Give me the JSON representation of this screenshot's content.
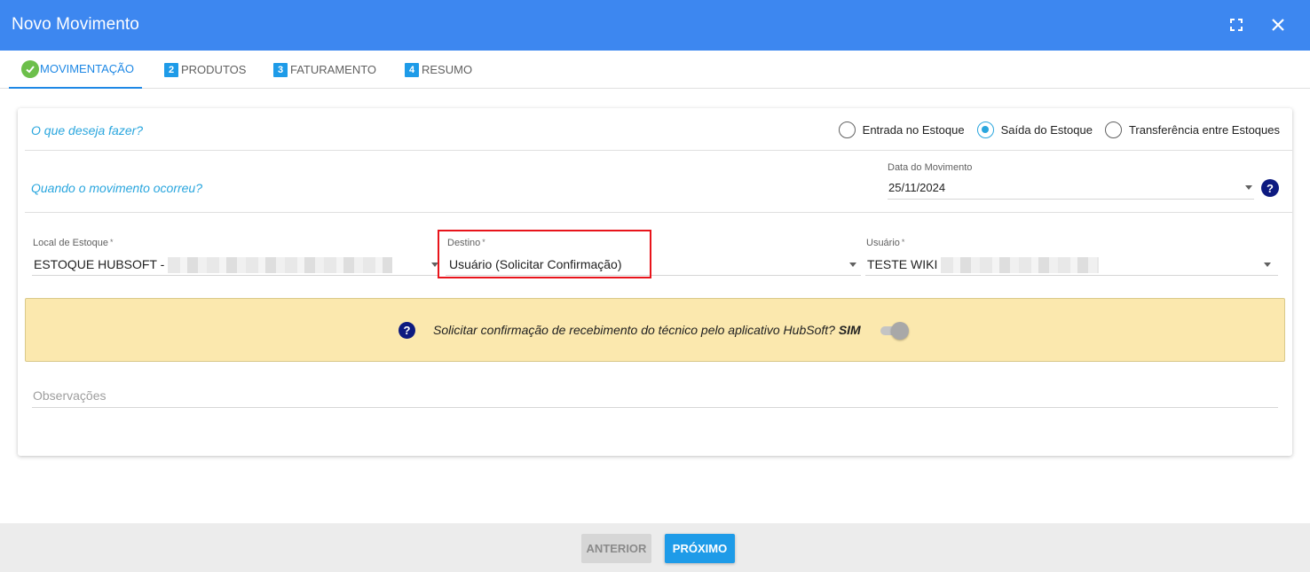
{
  "window": {
    "title": "Novo Movimento",
    "maximize_icon": "fullscreen-icon",
    "close_icon": "close-icon"
  },
  "tabs": [
    {
      "label": "MOVIMENTAÇÃO",
      "badge": "",
      "state": "completed"
    },
    {
      "label": "PRODUTOS",
      "badge": "2",
      "state": "pending"
    },
    {
      "label": "FATURAMENTO",
      "badge": "3",
      "state": "pending"
    },
    {
      "label": "RESUMO",
      "badge": "4",
      "state": "pending"
    }
  ],
  "section_action": {
    "question": "O que deseja fazer?",
    "options": [
      {
        "label": "Entrada no Estoque",
        "selected": false
      },
      {
        "label": "Saída do Estoque",
        "selected": true
      },
      {
        "label": "Transferência entre Estoques",
        "selected": false
      }
    ]
  },
  "section_date": {
    "question": "Quando o movimento ocorreu?",
    "label": "Data do Movimento",
    "value": "25/11/2024"
  },
  "fields": {
    "local": {
      "label": "Local de Estoque",
      "required_mark": "*",
      "value": "ESTOQUE HUBSOFT - "
    },
    "destino": {
      "label": "Destino",
      "required_mark": "*",
      "value": "Usuário (Solicitar Confirmação)"
    },
    "usuario": {
      "label": "Usuário",
      "required_mark": "*",
      "value": "TESTE WIKI"
    }
  },
  "notice": {
    "text": "Solicitar confirmação de recebimento do técnico pelo aplicativo HubSoft?",
    "answer": "SIM",
    "toggle_on": true
  },
  "observacoes": {
    "placeholder": "Observações"
  },
  "footer": {
    "prev_label": "ANTERIOR",
    "next_label": "PRÓXIMO"
  },
  "colors": {
    "header": "#3d87f0",
    "accent": "#1e9be8",
    "question": "#2aa6de",
    "notice_bg": "#fbe8ae",
    "highlight": "#e8141b"
  }
}
